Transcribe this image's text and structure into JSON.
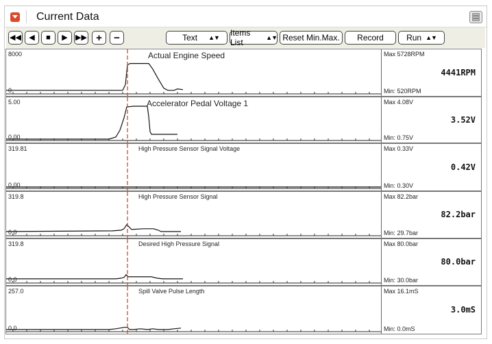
{
  "window": {
    "title": "Current Data"
  },
  "toolbar": {
    "text_select": "Text",
    "items_list": "Items List",
    "reset": "Reset Min.Max.",
    "record": "Record",
    "run_select": "Run"
  },
  "cursor_color": "#d9362b",
  "panels": [
    {
      "title": "Actual Engine Speed",
      "y_max": "8000",
      "y_min": "0",
      "max": "Max  5728RPM",
      "min": "Min:   520RPM",
      "value": "4441RPM"
    },
    {
      "title": "Accelerator Pedal Voltage 1",
      "y_max": "5.00",
      "y_min": "0.00",
      "max": "Max  4.08V",
      "min": "Min:  0.75V",
      "value": "3.52V"
    },
    {
      "title": "High Pressure Sensor Signal Voltage",
      "y_max": "319.81",
      "y_min": "0.00",
      "max": "Max  0.33V",
      "min": "Min:  0.30V",
      "value": "0.42V"
    },
    {
      "title": "High Pressure Sensor Signal",
      "y_max": "319.8",
      "y_min": "0.0",
      "max": "Max  82.2bar",
      "min": "Min:  29.7bar",
      "value": "82.2bar"
    },
    {
      "title": "Desired High Pressure Signal",
      "y_max": "319.8",
      "y_min": "0.0",
      "max": "Max  80.0bar",
      "min": "Min:  30.0bar",
      "value": "80.0bar"
    },
    {
      "title": "Spill Valve Pulse Length",
      "y_max": "257.0",
      "y_min": "0.0",
      "max": "Max  16.1mS",
      "min": "Min:   0.0mS",
      "value": "3.0mS"
    }
  ]
}
